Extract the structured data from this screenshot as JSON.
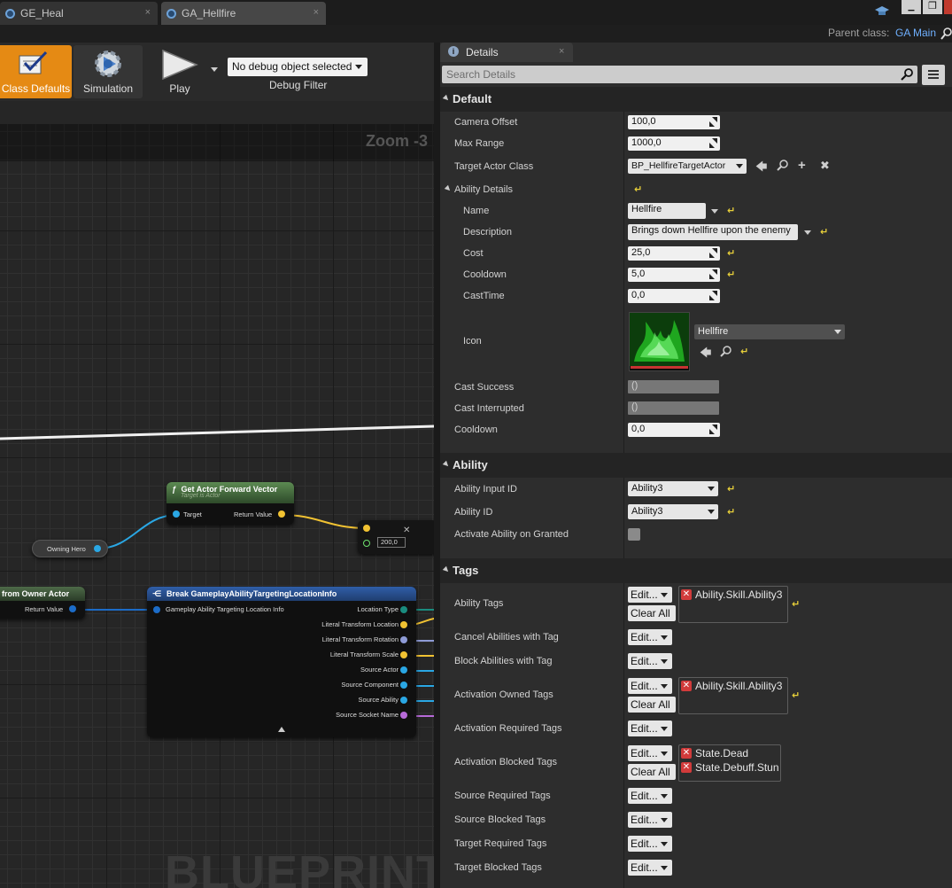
{
  "tabs": [
    {
      "label": "GE_Heal",
      "close": "×"
    },
    {
      "label": "GA_Hellfire",
      "close": "×"
    }
  ],
  "window_controls": {
    "minimize": "▁",
    "maximize": "❐"
  },
  "parent_class": {
    "label": "Parent class:",
    "value": "GA Main"
  },
  "toolbar": {
    "class_defaults": "Class Defaults",
    "simulation": "Simulation",
    "play": "Play",
    "debug_select": "No debug object selected",
    "debug_filter": "Debug Filter"
  },
  "graph": {
    "zoom": "Zoom -3",
    "watermark": "BLUEPRINT",
    "node_forward": {
      "title": "Get Actor Forward Vector",
      "subtitle": "Target is Actor",
      "pin_in": "Target",
      "pin_out": "Return Value"
    },
    "node_owning": {
      "label": "Owning Hero"
    },
    "node_mult": {
      "value": "200,0"
    },
    "node_owner": {
      "title": "from Owner Actor",
      "pin_out": "Return Value"
    },
    "node_break": {
      "title": "Break GameplayAbilityTargetingLocationInfo",
      "pin_in": "Gameplay Ability Targeting Location Info",
      "pins": [
        "Location Type",
        "Literal Transform Location",
        "Literal Transform Rotation",
        "Literal Transform Scale",
        "Source Actor",
        "Source Component",
        "Source Ability",
        "Source Socket Name"
      ]
    }
  },
  "details": {
    "tab_title": "Details",
    "tab_close": "×",
    "search_placeholder": "Search Details",
    "categories": {
      "default": "Default",
      "ability": "Ability",
      "tags": "Tags"
    },
    "camera_offset": {
      "label": "Camera Offset",
      "value": "100,0"
    },
    "max_range": {
      "label": "Max Range",
      "value": "1000,0"
    },
    "target_actor_class": {
      "label": "Target Actor Class",
      "value": "BP_HellfireTargetActor"
    },
    "ability_details": {
      "label": "Ability Details"
    },
    "name": {
      "label": "Name",
      "value": "Hellfire"
    },
    "description": {
      "label": "Description",
      "value": "Brings down Hellfire upon the enemy"
    },
    "cost": {
      "label": "Cost",
      "value": "25,0"
    },
    "cooldown": {
      "label": "Cooldown",
      "value": "5,0"
    },
    "cast_time": {
      "label": "CastTime",
      "value": "0,0"
    },
    "icon": {
      "label": "Icon",
      "value": "Hellfire"
    },
    "cast_success": {
      "label": "Cast Success",
      "value": "()"
    },
    "cast_interrupted": {
      "label": "Cast Interrupted",
      "value": "()"
    },
    "cooldown2": {
      "label": "Cooldown",
      "value": "0,0"
    },
    "ability_input_id": {
      "label": "Ability Input ID",
      "value": "Ability3"
    },
    "ability_id": {
      "label": "Ability ID",
      "value": "Ability3"
    },
    "activate_on_granted": {
      "label": "Activate Ability on Granted",
      "checked": false
    },
    "edit_label": "Edit...",
    "clear_all_label": "Clear All",
    "tag_rows": [
      {
        "label": "Ability Tags",
        "tags": [
          "Ability.Skill.Ability3"
        ]
      },
      {
        "label": "Cancel Abilities with Tag",
        "tags": []
      },
      {
        "label": "Block Abilities with Tag",
        "tags": []
      },
      {
        "label": "Activation Owned Tags",
        "tags": [
          "Ability.Skill.Ability3"
        ]
      },
      {
        "label": "Activation Required Tags",
        "tags": []
      },
      {
        "label": "Activation Blocked Tags",
        "tags": [
          "State.Dead",
          "State.Debuff.Stun"
        ]
      },
      {
        "label": "Source Required Tags",
        "tags": []
      },
      {
        "label": "Source Blocked Tags",
        "tags": []
      },
      {
        "label": "Target Required Tags",
        "tags": []
      },
      {
        "label": "Target Blocked Tags",
        "tags": []
      }
    ]
  }
}
